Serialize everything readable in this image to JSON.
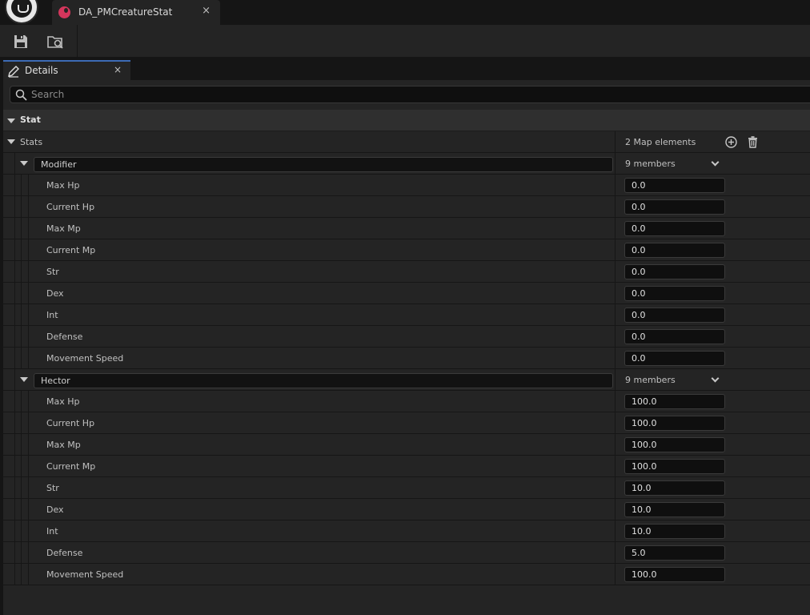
{
  "window": {
    "tab_title": "DA_PMCreatureStat",
    "tab_close": "×"
  },
  "toolbar": {
    "save_icon": "save-icon",
    "browse_icon": "browse-content-icon"
  },
  "details": {
    "tab_label": "Details",
    "tab_close": "×",
    "search_placeholder": "Search",
    "category": "Stat",
    "property": {
      "label": "Stats",
      "summary": "2 Map elements"
    },
    "entries": [
      {
        "key": "Modifier",
        "summary": "9 members",
        "fields": [
          {
            "label": "Max Hp",
            "value": "0.0"
          },
          {
            "label": "Current Hp",
            "value": "0.0"
          },
          {
            "label": "Max Mp",
            "value": "0.0"
          },
          {
            "label": "Current Mp",
            "value": "0.0"
          },
          {
            "label": "Str",
            "value": "0.0"
          },
          {
            "label": "Dex",
            "value": "0.0"
          },
          {
            "label": "Int",
            "value": "0.0"
          },
          {
            "label": "Defense",
            "value": "0.0"
          },
          {
            "label": "Movement Speed",
            "value": "0.0"
          }
        ]
      },
      {
        "key": "Hector",
        "summary": "9 members",
        "fields": [
          {
            "label": "Max Hp",
            "value": "100.0"
          },
          {
            "label": "Current Hp",
            "value": "100.0"
          },
          {
            "label": "Max Mp",
            "value": "100.0"
          },
          {
            "label": "Current Mp",
            "value": "100.0"
          },
          {
            "label": "Str",
            "value": "10.0"
          },
          {
            "label": "Dex",
            "value": "10.0"
          },
          {
            "label": "Int",
            "value": "10.0"
          },
          {
            "label": "Defense",
            "value": "5.0"
          },
          {
            "label": "Movement Speed",
            "value": "100.0"
          }
        ]
      }
    ]
  },
  "colors": {
    "accent": "#3d6bb5",
    "asset_icon": "#d4365c",
    "panel_bg": "#242424",
    "window_bg": "#151515"
  }
}
